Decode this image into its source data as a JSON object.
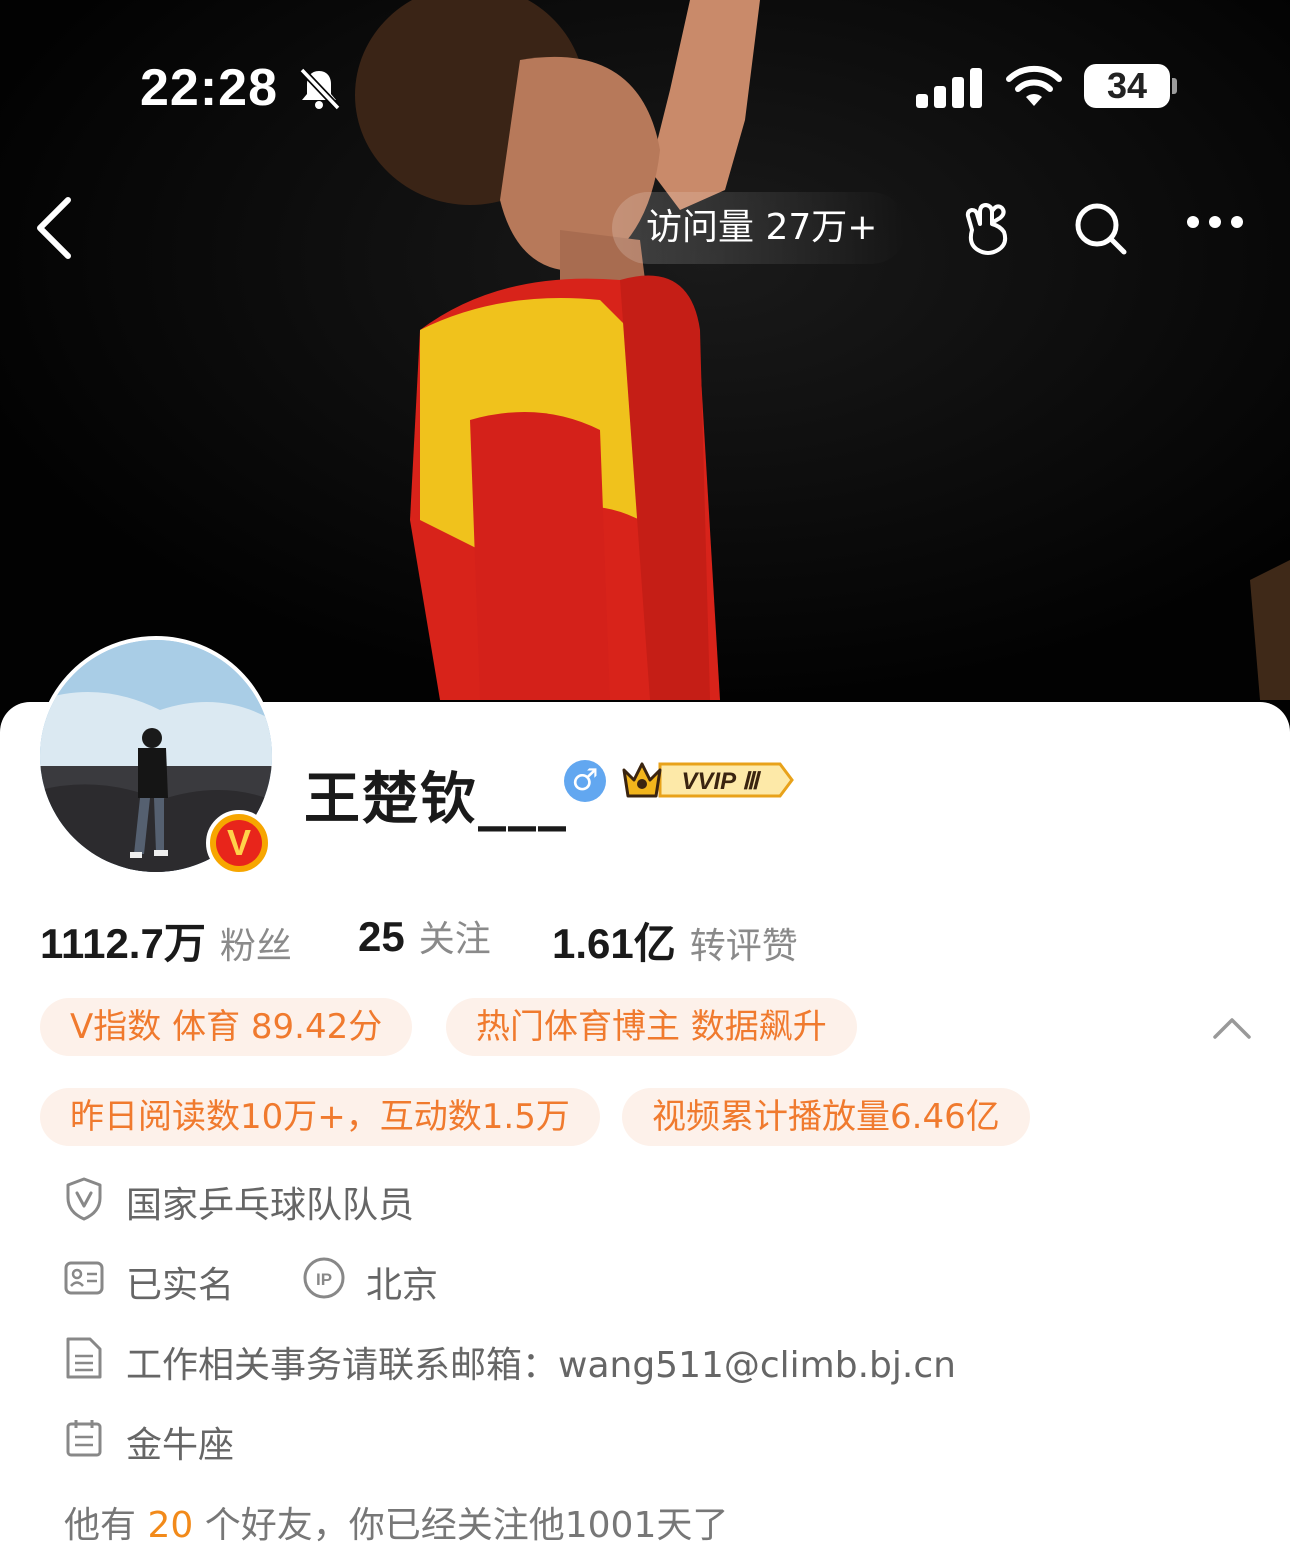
{
  "status_bar": {
    "time": "22:28",
    "battery": "34",
    "icons": [
      "bell-off-icon",
      "signal-icon",
      "wifi-icon",
      "battery-icon"
    ]
  },
  "nav": {
    "visits_label": "访问量 27万+",
    "icons": [
      "back-icon",
      "hand-heart-icon",
      "search-icon",
      "more-icon"
    ]
  },
  "profile": {
    "name": "王楚钦___",
    "gender_symbol": "♂",
    "verified_badge": "V",
    "vip_badge": "VVIP Ⅲ"
  },
  "stats": [
    {
      "value": "1112.7万",
      "label": "粉丝"
    },
    {
      "value": "25",
      "label": "关注"
    },
    {
      "value": "1.61亿",
      "label": "转评赞"
    }
  ],
  "tags": [
    "V指数 体育 89.42分",
    "热门体育博主 数据飙升",
    "昨日阅读数10万+，互动数1.5万",
    "视频累计播放量6.46亿"
  ],
  "info": {
    "verification": "国家乒乓球队队员",
    "real_name": "已实名",
    "ip_location": "北京",
    "bio": "工作相关事务请联系邮箱：wang511@climb.bj.cn",
    "zodiac": "金牛座"
  },
  "friends": {
    "prefix": "他有",
    "count": "20",
    "suffix": "个好友，你已经关注他1001天了"
  },
  "colors": {
    "accent_orange": "#f07a2e",
    "tag_bg": "#fdf1ea",
    "gender_blue": "#62a7f0",
    "verified_red": "#e8251b"
  }
}
